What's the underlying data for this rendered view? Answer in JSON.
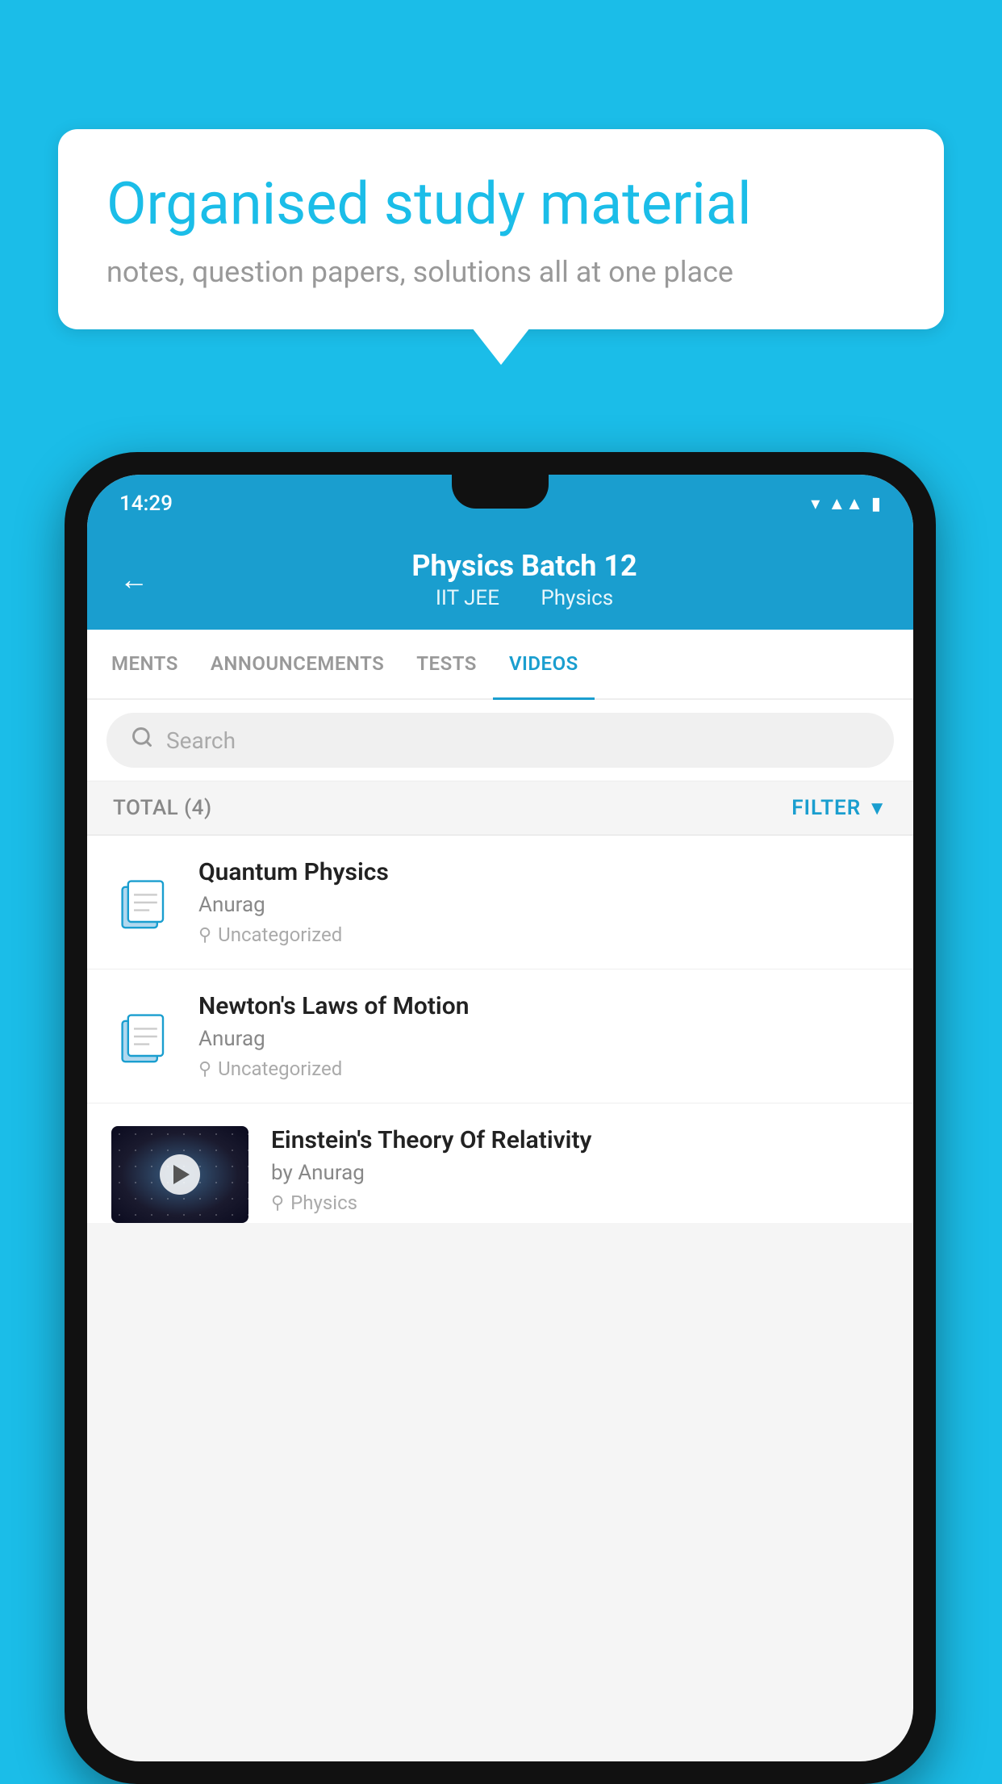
{
  "background_color": "#1bbde8",
  "bubble": {
    "title": "Organised study material",
    "subtitle": "notes, question papers, solutions all at one place"
  },
  "phone": {
    "status_bar": {
      "time": "14:29"
    },
    "header": {
      "back_label": "←",
      "title": "Physics Batch 12",
      "subtitle_part1": "IIT JEE",
      "subtitle_part2": "Physics"
    },
    "tabs": [
      {
        "label": "MENTS",
        "active": false
      },
      {
        "label": "ANNOUNCEMENTS",
        "active": false
      },
      {
        "label": "TESTS",
        "active": false
      },
      {
        "label": "VIDEOS",
        "active": true
      }
    ],
    "search": {
      "placeholder": "Search"
    },
    "filter_bar": {
      "total_label": "TOTAL (4)",
      "filter_label": "FILTER"
    },
    "videos": [
      {
        "id": 1,
        "title": "Quantum Physics",
        "author": "Anurag",
        "tag": "Uncategorized",
        "has_thumb": false
      },
      {
        "id": 2,
        "title": "Newton's Laws of Motion",
        "author": "Anurag",
        "tag": "Uncategorized",
        "has_thumb": false
      },
      {
        "id": 3,
        "title": "Einstein's Theory Of Relativity",
        "author": "by Anurag",
        "tag": "Physics",
        "has_thumb": true
      }
    ]
  }
}
